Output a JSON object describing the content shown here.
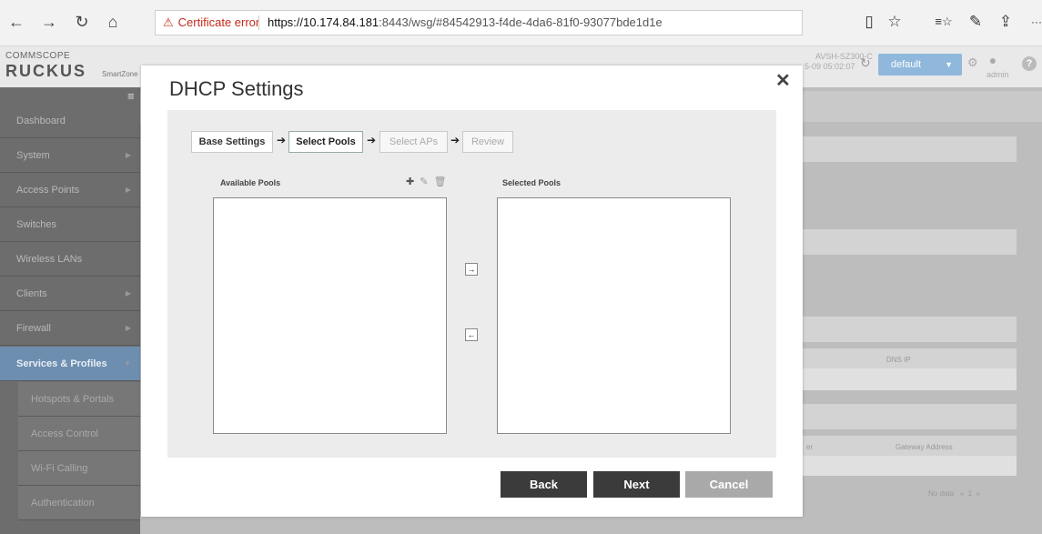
{
  "browser": {
    "back_icon": "←",
    "forward_icon": "→",
    "refresh_icon": "↻",
    "home_icon": "⌂",
    "cert_icon": "⚠",
    "cert_text": "Certificate error",
    "url_host": "https://10.174.84.181",
    "url_path": ":8443/wsg/#84542913-f4de-4da6-81f0-93077bde1d1e",
    "reader_icon": "▯",
    "favorite_icon": "☆",
    "favorites_list_icon": "≡☆",
    "notes_icon": "✎",
    "share_icon": "⇪",
    "more_icon": "···"
  },
  "app": {
    "brand_top": "COMMSCOPE",
    "brand_main": "RUCKUS",
    "brand_sub": "SmartZone",
    "controller_name": "AVSH-SZ300-C",
    "controller_time": "5-09 05:02:07",
    "domain_select": "default",
    "admin_label": "admin",
    "help": "?"
  },
  "sidebar": {
    "items": [
      {
        "label": "Dashboard"
      },
      {
        "label": "System"
      },
      {
        "label": "Access Points"
      },
      {
        "label": "Switches"
      },
      {
        "label": "Wireless LANs"
      },
      {
        "label": "Clients"
      },
      {
        "label": "Firewall"
      },
      {
        "label": "Services & Profiles"
      }
    ],
    "subitems": [
      {
        "label": "Hotspots & Portals"
      },
      {
        "label": "Access Control"
      },
      {
        "label": "Wi-Fi Calling"
      },
      {
        "label": "Authentication"
      }
    ]
  },
  "background": {
    "col_dns_ip": "DNS IP",
    "col_gateway": "Gateway Address",
    "col_partial": "er",
    "pagination": "No data   «  1  »"
  },
  "modal": {
    "title": "DHCP Settings",
    "close": "✕",
    "steps": [
      {
        "label": "Base Settings",
        "state": "done"
      },
      {
        "label": "Select Pools",
        "state": "current"
      },
      {
        "label": "Select APs",
        "state": "todo"
      },
      {
        "label": "Review",
        "state": "todo"
      }
    ],
    "step_arrow": "➔",
    "available_label": "Available Pools",
    "selected_label": "Selected Pools",
    "move_right": "→",
    "move_left": "←",
    "tool_add": "✚",
    "tool_edit": "✎",
    "tool_delete": "🗑",
    "buttons": {
      "back": "Back",
      "next": "Next",
      "cancel": "Cancel"
    }
  }
}
